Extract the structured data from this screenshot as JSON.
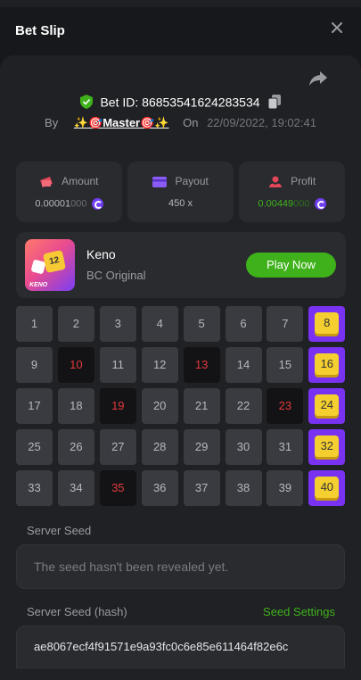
{
  "header": {
    "title": "Bet Slip"
  },
  "bet": {
    "id": "Bet ID: 86853541624283534",
    "by_label": "By",
    "user": "✨🎯Master🎯✨",
    "on_label": "On",
    "date": "22/09/2022, 19:02:41"
  },
  "stats": {
    "amount_label": "Amount",
    "amount_value": "0.00001",
    "amount_value_dim": "000",
    "payout_label": "Payout",
    "payout_value": "450 x",
    "profit_label": "Profit",
    "profit_value": "0.00449",
    "profit_value_dim": "000"
  },
  "game": {
    "thumb_label": "KENO",
    "thumb_number": "12",
    "name": "Keno",
    "provider": "BC Original",
    "play_label": "Play Now"
  },
  "keno": {
    "numbers": [
      "1",
      "2",
      "3",
      "4",
      "5",
      "6",
      "7",
      "8",
      "9",
      "10",
      "11",
      "12",
      "13",
      "14",
      "15",
      "16",
      "17",
      "18",
      "19",
      "20",
      "21",
      "22",
      "23",
      "24",
      "25",
      "26",
      "27",
      "28",
      "29",
      "30",
      "31",
      "32",
      "33",
      "34",
      "35",
      "36",
      "37",
      "38",
      "39",
      "40"
    ],
    "hits": [
      "8",
      "16",
      "24",
      "32",
      "40"
    ],
    "misses": [
      "10",
      "13",
      "19",
      "23",
      "35"
    ]
  },
  "seed": {
    "server_label": "Server Seed",
    "server_placeholder": "The seed hasn't been revealed yet.",
    "hash_label": "Server Seed (hash)",
    "settings_label": "Seed Settings",
    "hash_value": "ae8067ecf4f91571e9a93fc0c6e85e611464f82e6c"
  },
  "colors": {
    "accent_green": "#3fb21b",
    "hit_purple": "#7a32f2",
    "gem_yellow": "#f5cf2f",
    "miss_red": "#e23a3a"
  }
}
